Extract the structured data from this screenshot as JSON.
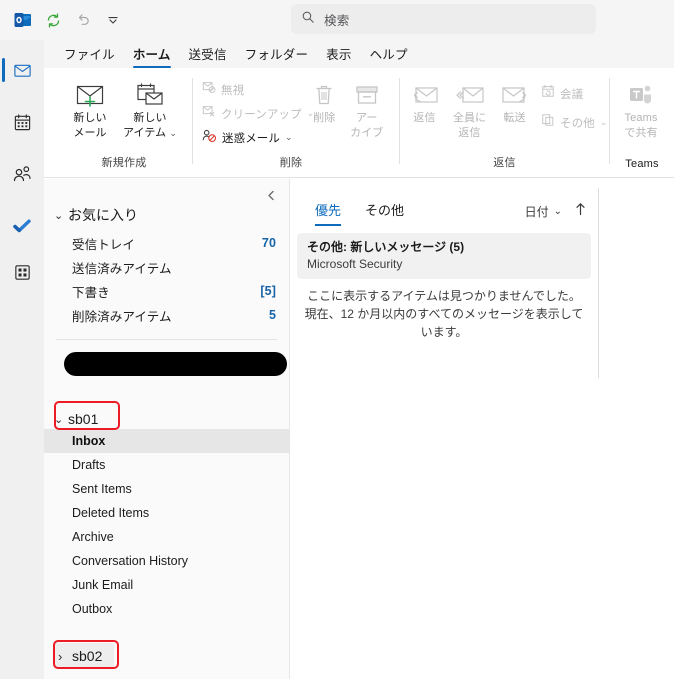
{
  "window": {
    "app_icon": "outlook-logo-icon",
    "quick_access": [
      {
        "name": "sync-icon",
        "label": "送受信"
      },
      {
        "name": "undo-icon",
        "label": "元に戻す"
      },
      {
        "name": "customize-chevron-icon",
        "label": "クイック アクセス ツール バーのユーザー設定"
      }
    ]
  },
  "search": {
    "icon": "search-icon",
    "placeholder": "検索",
    "value": ""
  },
  "menubar": {
    "tabs": [
      {
        "label": "ファイル",
        "active": false
      },
      {
        "label": "ホーム",
        "active": true
      },
      {
        "label": "送受信",
        "active": false
      },
      {
        "label": "フォルダー",
        "active": false
      },
      {
        "label": "表示",
        "active": false
      },
      {
        "label": "ヘルプ",
        "active": false
      }
    ]
  },
  "ribbon": {
    "groups": [
      {
        "label": "新規作成",
        "buttons": [
          {
            "name": "new-mail-button",
            "label_line1": "新しい",
            "label_line2": "メール",
            "icon": "new-mail-icon",
            "disabled": false,
            "chevron": false
          },
          {
            "name": "new-items-button",
            "label_line1": "新しい",
            "label_line2": "アイテム",
            "icon": "new-items-icon",
            "disabled": false,
            "chevron": true
          }
        ]
      },
      {
        "label": "削除",
        "small_buttons": [
          {
            "name": "ignore-button",
            "label": "無視",
            "icon": "ignore-icon",
            "disabled": true,
            "chevron": false
          },
          {
            "name": "cleanup-button",
            "label": "クリーンアップ",
            "icon": "cleanup-icon",
            "disabled": true,
            "chevron": true
          },
          {
            "name": "junk-mail-button",
            "label": "迷惑メール",
            "icon": "junk-mail-icon",
            "disabled": false,
            "chevron": true
          }
        ],
        "buttons": [
          {
            "name": "delete-button",
            "label_line1": "削除",
            "label_line2": "",
            "icon": "trash-icon",
            "disabled": true,
            "chevron": false
          },
          {
            "name": "archive-button",
            "label_line1": "アー",
            "label_line2": "カイブ",
            "icon": "archive-icon",
            "disabled": true,
            "chevron": false
          }
        ]
      },
      {
        "label": "返信",
        "buttons": [
          {
            "name": "reply-button",
            "label_line1": "返信",
            "label_line2": "",
            "icon": "reply-icon",
            "disabled": true,
            "chevron": false
          },
          {
            "name": "reply-all-button",
            "label_line1": "全員に",
            "label_line2": "返信",
            "icon": "reply-all-icon",
            "disabled": true,
            "chevron": false
          },
          {
            "name": "forward-button",
            "label_line1": "転送",
            "label_line2": "",
            "icon": "forward-icon",
            "disabled": true,
            "chevron": false
          }
        ],
        "small_buttons": [
          {
            "name": "meeting-button",
            "label": "会議",
            "icon": "meeting-icon",
            "disabled": true,
            "chevron": false
          },
          {
            "name": "more-respond-button",
            "label": "その他",
            "icon": "more-icon",
            "disabled": true,
            "chevron": true
          }
        ]
      },
      {
        "label": "Teams",
        "buttons": [
          {
            "name": "share-to-teams-button",
            "label_line1": "Teams",
            "label_line2": "で共有",
            "icon": "teams-icon",
            "disabled": true,
            "chevron": false
          }
        ]
      }
    ]
  },
  "rail": {
    "items": [
      {
        "name": "rail-item-mail",
        "icon": "mail-icon",
        "label": "メール",
        "selected": true
      },
      {
        "name": "rail-item-calendar",
        "icon": "calendar-icon",
        "label": "予定表",
        "selected": false
      },
      {
        "name": "rail-item-people",
        "icon": "people-icon",
        "label": "連絡先",
        "selected": false
      },
      {
        "name": "rail-item-todo",
        "icon": "checkmark-icon",
        "label": "To Do",
        "selected": false
      },
      {
        "name": "rail-item-apps",
        "icon": "apps-grid-icon",
        "label": "アプリ",
        "selected": false
      }
    ]
  },
  "folder_pane": {
    "collapse_icon": "chevron-left-icon",
    "favorites": {
      "twisty": "⌄",
      "label": "お気に入り",
      "expanded": true,
      "items": [
        {
          "name": "folder-inbox-fav",
          "label": "受信トレイ",
          "count": "70"
        },
        {
          "name": "folder-sent-fav",
          "label": "送信済みアイテム",
          "count": ""
        },
        {
          "name": "folder-drafts-fav",
          "label": "下書き",
          "count": "[5]"
        },
        {
          "name": "folder-deleted-fav",
          "label": "削除済みアイテム",
          "count": "5"
        }
      ]
    },
    "redacted_account": "",
    "accounts": [
      {
        "name": "account-sb01",
        "label": "sb01",
        "twisty": "⌄",
        "expanded": true,
        "annotated": true,
        "folders": [
          {
            "name": "folder-inbox",
            "label": "Inbox",
            "selected": true
          },
          {
            "name": "folder-drafts",
            "label": "Drafts",
            "selected": false
          },
          {
            "name": "folder-sent-items",
            "label": "Sent Items",
            "selected": false
          },
          {
            "name": "folder-deleted-items",
            "label": "Deleted Items",
            "selected": false
          },
          {
            "name": "folder-archive",
            "label": "Archive",
            "selected": false
          },
          {
            "name": "folder-conversation-history",
            "label": "Conversation History",
            "selected": false
          },
          {
            "name": "folder-junk-email",
            "label": "Junk Email",
            "selected": false
          },
          {
            "name": "folder-outbox",
            "label": "Outbox",
            "selected": false
          }
        ]
      },
      {
        "name": "account-sb02",
        "label": "sb02",
        "twisty": "›",
        "expanded": false,
        "annotated": true,
        "folders": []
      }
    ]
  },
  "message_list": {
    "tabs": [
      {
        "name": "tab-focused",
        "label": "優先",
        "active": true
      },
      {
        "name": "tab-other",
        "label": "その他",
        "active": false
      }
    ],
    "sort": {
      "label": "日付",
      "chevron": "⌄",
      "direction_icon": "arrow-up-icon"
    },
    "card": {
      "subject": "その他: 新しいメッセージ (5)",
      "sender": "Microsoft Security"
    },
    "empty_state_line1": "ここに表示するアイテムは見つかりませんでした。",
    "empty_state_line2": "現在、12 か月以内のすべてのメッセージを表示しています。"
  },
  "colors": {
    "accent": "#0f6cbd",
    "count_blue": "#1763a8",
    "annotation_red": "#ed1c24",
    "selected_row": "#e6e6e6",
    "card_bg": "#f1f1f1"
  }
}
